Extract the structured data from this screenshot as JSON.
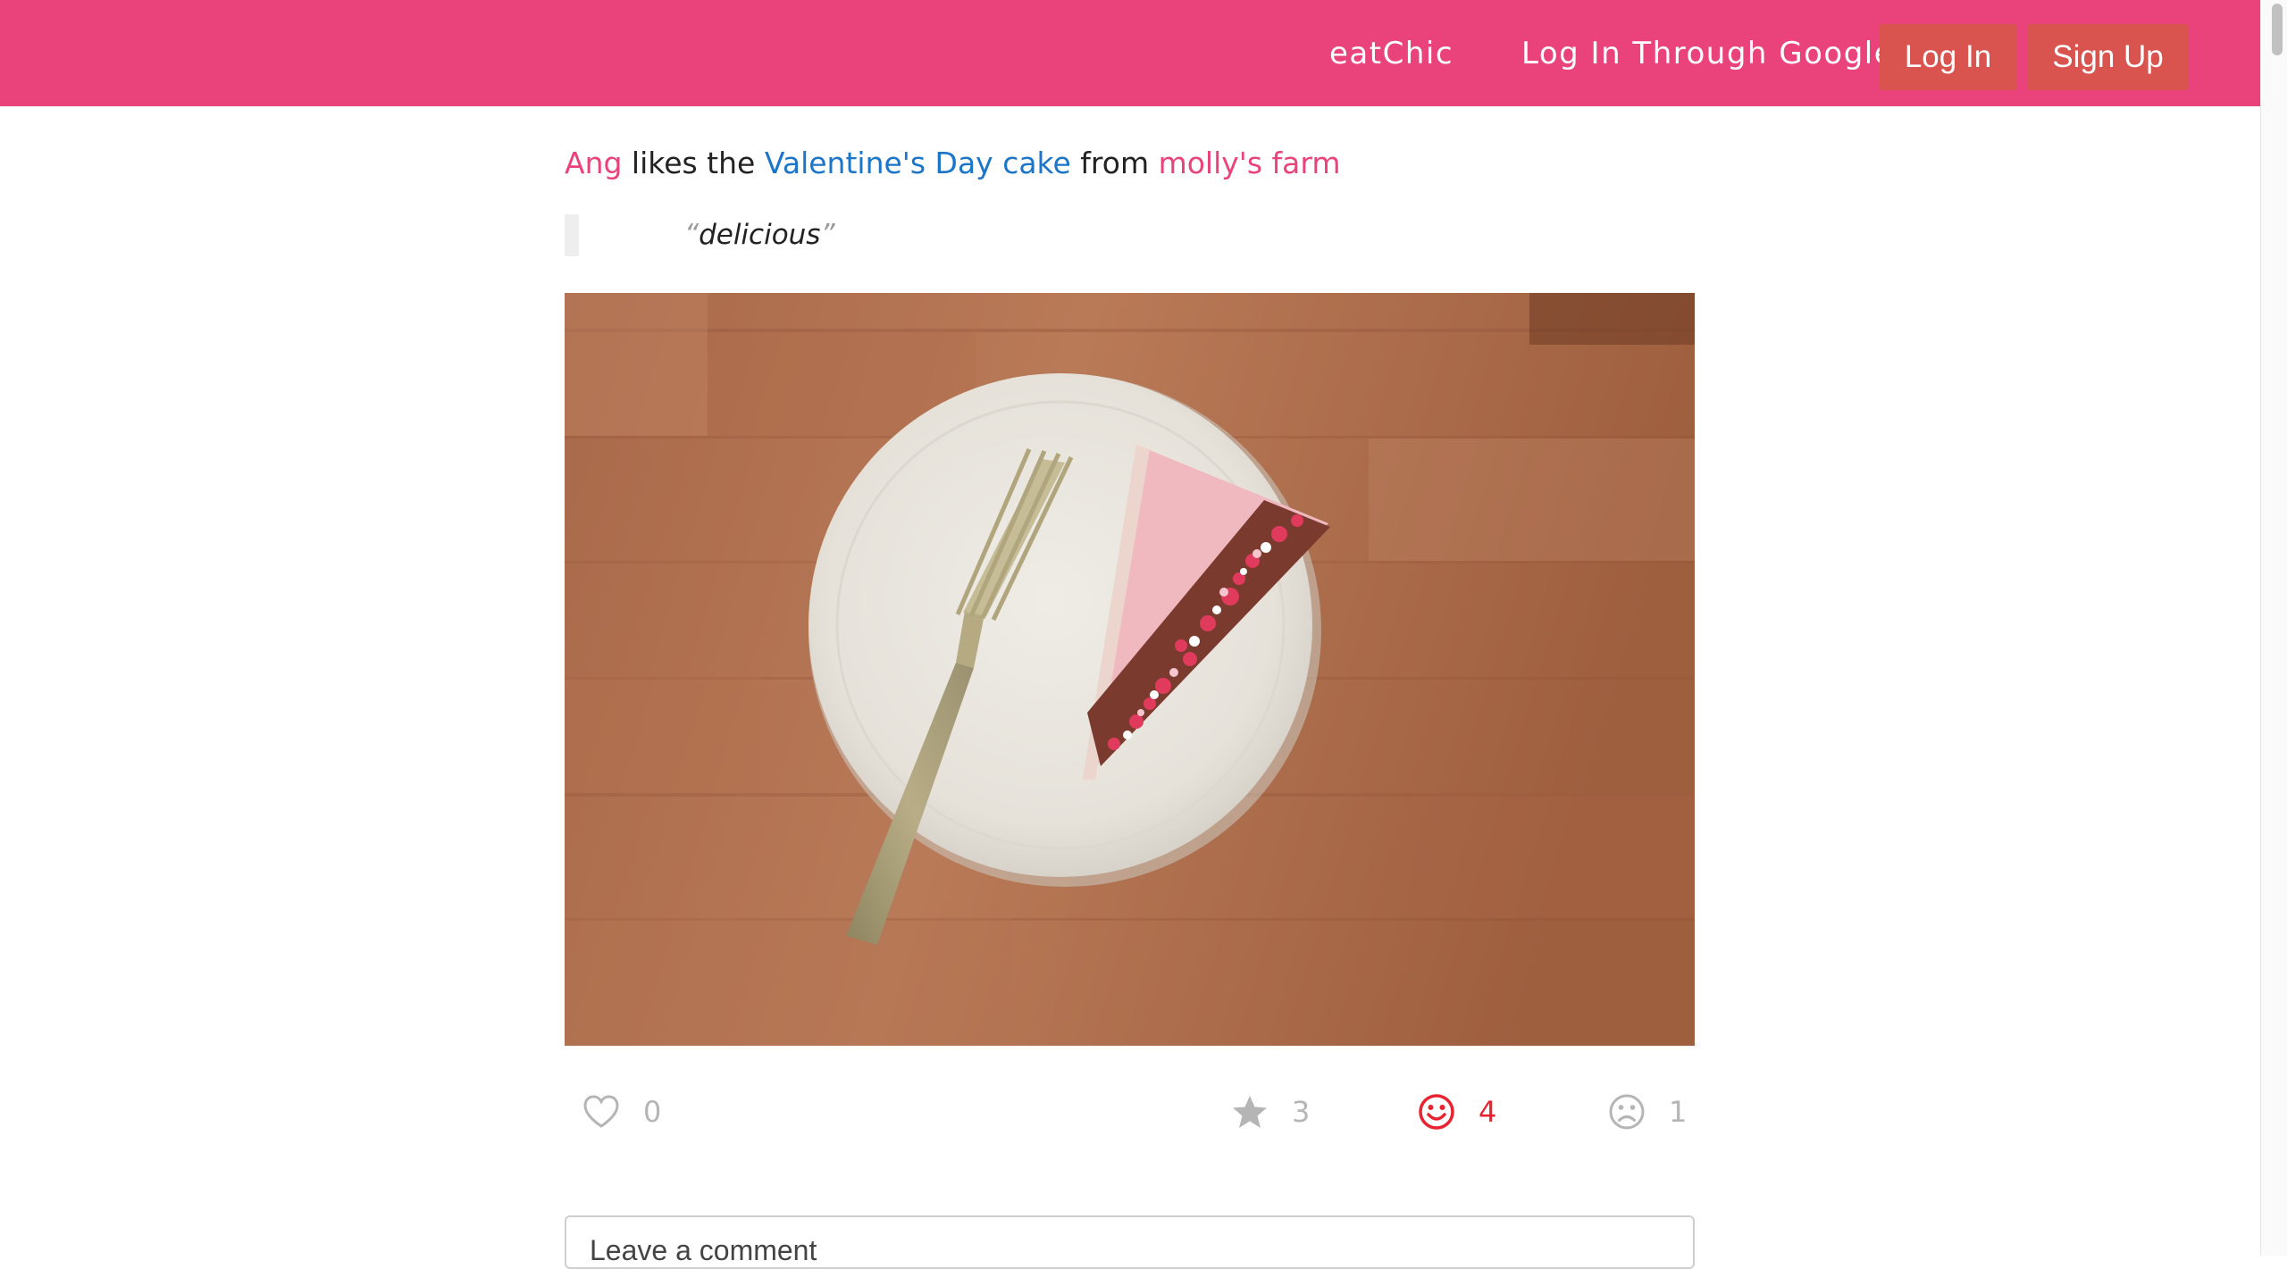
{
  "nav": {
    "brand": "eatChic",
    "google_login": "Log In Through Google",
    "login": "Log In",
    "signup": "Sign Up"
  },
  "post": {
    "user": "Ang",
    "verb": " likes the ",
    "dish": "Valentine's Day cake",
    "connector": " from ",
    "place": "molly's farm",
    "review": "delicious",
    "open_quote": "“",
    "close_quote": "”"
  },
  "reactions": {
    "love": {
      "icon": "heart-outline-icon",
      "count": "0"
    },
    "star": {
      "icon": "star-icon",
      "count": "3"
    },
    "happy": {
      "icon": "smiley-icon",
      "count": "4"
    },
    "sad": {
      "icon": "frown-icon",
      "count": "1"
    }
  },
  "comment": {
    "placeholder": "Leave a comment"
  },
  "colors": {
    "brand_pink": "#ea437c",
    "button_red": "#d9534f",
    "link_blue": "#1b75c9",
    "active_red": "#e8232f",
    "muted_gray": "#b5b5b5"
  }
}
